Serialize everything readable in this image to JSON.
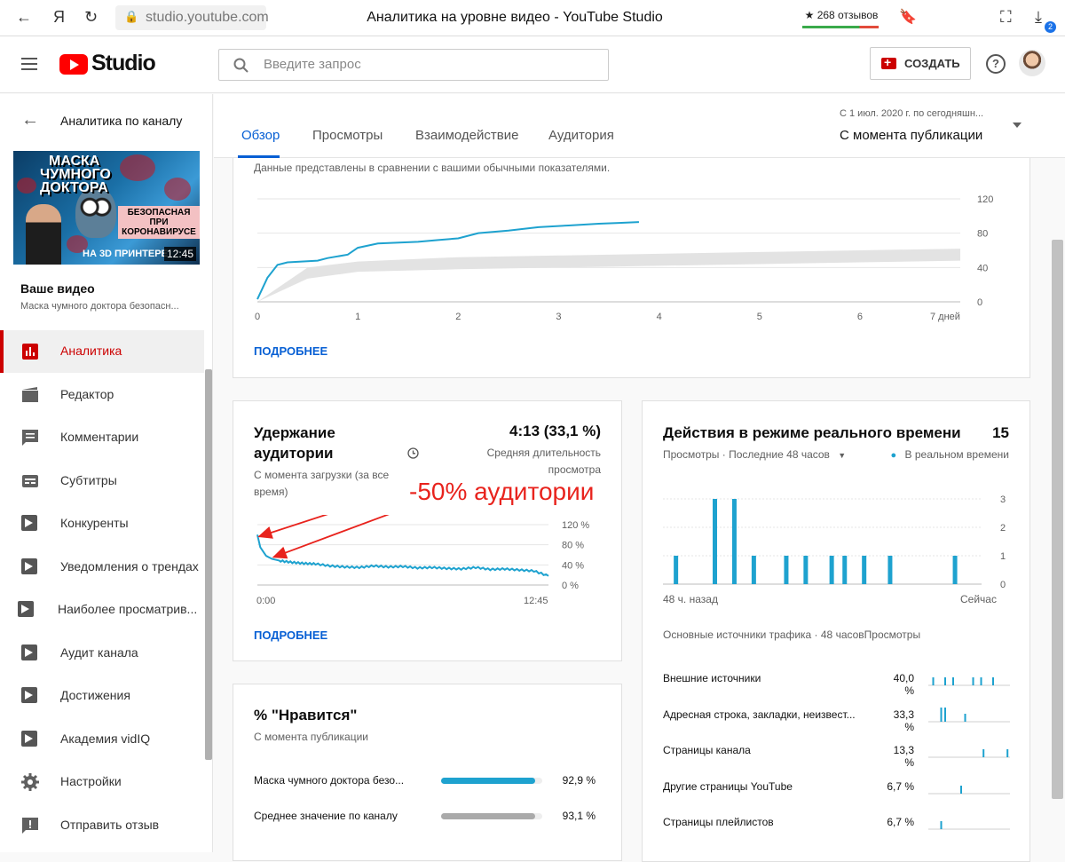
{
  "browser": {
    "url": "studio.youtube.com",
    "title": "Аналитика на уровне видео - YouTube Studio",
    "reviews": "★ 268 отзывов",
    "download_badge": "2",
    "yandex_label": "Я"
  },
  "header": {
    "logo_text": "Studio",
    "search_placeholder": "Введите запрос",
    "create_label": "СОЗДАТЬ",
    "help_label": "?"
  },
  "sidebar": {
    "back_label": "Аналитика по каналу",
    "thumbnail": {
      "line1": "МАСКА",
      "line2": "ЧУМНОГО",
      "line3": "ДОКТОРА",
      "right_text": "БЕЗОПАСНАЯ ПРИ КОРОНАВИРУСЕ",
      "bottom_text": "НА 3D ПРИНТЕРЕ",
      "duration": "12:45"
    },
    "your_video_label": "Ваше видео",
    "video_title": "Маска чумного доктора безопасн...",
    "items": [
      {
        "label": "Аналитика",
        "icon": "analytics-icon",
        "active": true
      },
      {
        "label": "Редактор",
        "icon": "editor-icon"
      },
      {
        "label": "Комментарии",
        "icon": "comments-icon"
      },
      {
        "label": "Субтитры",
        "icon": "subtitles-icon"
      },
      {
        "label": "Конкуренты",
        "icon": "vidiq-icon"
      },
      {
        "label": "Уведомления о трендах",
        "icon": "vidiq-icon"
      },
      {
        "label": "Наиболее просматрив...",
        "icon": "vidiq-icon"
      },
      {
        "label": "Аудит канала",
        "icon": "vidiq-icon"
      },
      {
        "label": "Достижения",
        "icon": "vidiq-icon"
      },
      {
        "label": "Академия vidIQ",
        "icon": "vidiq-icon"
      },
      {
        "label": "Настройки",
        "icon": "gear-icon"
      },
      {
        "label": "Отправить отзыв",
        "icon": "feedback-icon"
      }
    ]
  },
  "tabs": [
    "Обзор",
    "Просмотры",
    "Взаимодействие",
    "Аудитория"
  ],
  "date": {
    "range": "С 1 июл. 2020 г. по сегодняшн...",
    "value": "С момента публикации"
  },
  "views_card": {
    "note": "Данные представлены в сравнении с вашими обычными показателями.",
    "more_label": "ПОДРОБНЕЕ",
    "chart_data": {
      "type": "line",
      "x_ticks": [
        "0",
        "1",
        "2",
        "3",
        "4",
        "5",
        "6",
        "7 дней"
      ],
      "y_ticks": [
        "120",
        "80",
        "40",
        "0"
      ],
      "ylim": [
        0,
        120
      ],
      "xlim": [
        0,
        7
      ],
      "series": [
        {
          "x": [
            0,
            0.1,
            0.2,
            0.3,
            0.6,
            0.7,
            0.9,
            1.0,
            1.2,
            1.6,
            1.8,
            2.0,
            2.2,
            2.5,
            2.8,
            3.1,
            3.4,
            3.6,
            3.8
          ],
          "y": [
            3,
            28,
            43,
            46,
            48,
            51,
            55,
            63,
            68,
            70,
            72,
            74,
            80,
            83,
            87,
            89,
            91,
            92,
            93
          ]
        }
      ],
      "band": {
        "x": [
          0,
          0.5,
          1,
          2,
          3,
          4,
          5,
          6,
          7
        ],
        "lower": [
          0,
          27,
          35,
          38,
          40,
          42,
          44,
          46,
          48
        ],
        "upper": [
          0,
          40,
          47,
          52,
          54,
          56,
          58,
          60,
          62
        ]
      },
      "colors": {
        "line": "#1ea2cf",
        "band": "#e3e3e3"
      }
    }
  },
  "retention_card": {
    "title": "Удержание аудитории",
    "value": "4:13 (33,1 %)",
    "value_caption": "Средняя длительность просмотра",
    "subtitle": "С момента загрузки (за все время)",
    "annotation": "-50% аудитории",
    "more_label": "ПОДРОБНЕЕ",
    "chart_data": {
      "type": "line",
      "x_ticks": [
        "0:00",
        "12:45"
      ],
      "y_ticks": [
        "120 %",
        "80 %",
        "40 %",
        "0 %"
      ],
      "ylim": [
        0,
        120
      ],
      "series": [
        {
          "x": [
            0,
            0.01,
            0.03,
            0.05,
            0.08,
            0.12,
            0.16,
            0.2,
            0.25,
            0.3,
            0.35,
            0.4,
            0.45,
            0.5,
            0.55,
            0.6,
            0.65,
            0.7,
            0.75,
            0.8,
            0.85,
            0.9,
            0.95,
            1.0
          ],
          "y": [
            100,
            75,
            58,
            52,
            48,
            45,
            43,
            42,
            38,
            36,
            35,
            38,
            36,
            37,
            34,
            35,
            33,
            32,
            35,
            31,
            32,
            30,
            28,
            18
          ]
        }
      ],
      "colors": {
        "line": "#1ea2cf",
        "annotation": "#e8231d"
      }
    }
  },
  "realtime_card": {
    "title": "Действия в режиме реального времени",
    "value": "15",
    "filter": "Просмотры · Последние 48 часов",
    "legend": "В реальном времени",
    "x_start": "48 ч. назад",
    "x_end": "Сейчас",
    "chart_data": {
      "type": "bar",
      "x": [
        2,
        8,
        11,
        14,
        19,
        22,
        26,
        28,
        31,
        35,
        45
      ],
      "values": [
        1,
        3,
        3,
        1,
        1,
        1,
        1,
        1,
        1,
        1,
        1
      ],
      "x_range": [
        0,
        48
      ],
      "y_ticks": [
        "3",
        "2",
        "1",
        "0"
      ],
      "ylim": [
        0,
        3
      ],
      "colors": {
        "bar": "#1ea2cf"
      }
    },
    "sources_header": "Основные источники трафика · 48 часовПросмотры",
    "sources": [
      {
        "label": "Внешние источники",
        "value": "40,0 %",
        "spikes": [
          0.05,
          0.2,
          0.3,
          0.55,
          0.65,
          0.8
        ]
      },
      {
        "label": "Адресная строка, закладки, неизвест...",
        "value": "33,3 %",
        "spikes": [
          0.15,
          0.2,
          0.45
        ]
      },
      {
        "label": "Страницы канала",
        "value": "13,3 %",
        "spikes": [
          0.68,
          0.98
        ]
      },
      {
        "label": "Другие страницы YouTube",
        "value": "6,7 %",
        "spikes": [
          0.4
        ]
      },
      {
        "label": "Страницы плейлистов",
        "value": "6,7 %",
        "spikes": [
          0.15
        ]
      }
    ]
  },
  "likes_card": {
    "title": "% \"Нравится\"",
    "subtitle": "С момента публикации",
    "rows": [
      {
        "label": "Маска чумного доктора безо...",
        "value": "92,9 %",
        "fraction": 0.929,
        "color": "#1ea2cf"
      },
      {
        "label": "Среднее значение по каналу",
        "value": "93,1 %",
        "fraction": 0.931,
        "color": "#aaaaaa"
      }
    ]
  }
}
